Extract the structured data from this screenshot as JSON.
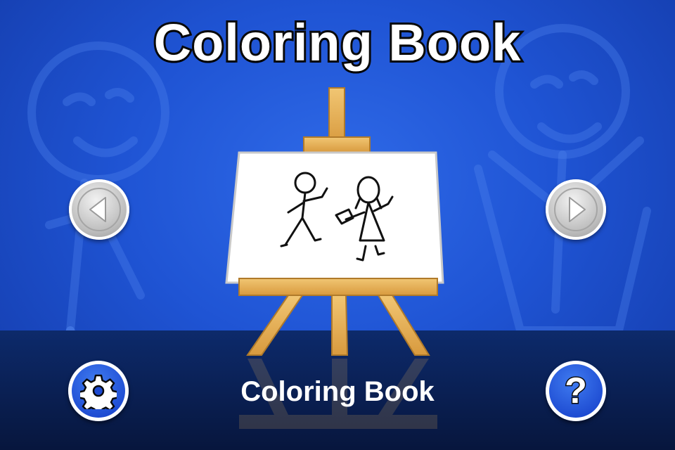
{
  "title": "Coloring Book",
  "caption": "Coloring Book",
  "help_label": "?",
  "icons": {
    "prev": "left-arrow-icon",
    "next": "right-arrow-icon",
    "settings": "gear-icon",
    "help": "question-mark-icon"
  },
  "colors": {
    "background": "#1f54d4",
    "floor": "#0d2a6b",
    "wood": "#e7b25b",
    "canvas": "#ffffff",
    "button_gray": "#bdbdbd",
    "button_blue": "#1d4ad1"
  }
}
